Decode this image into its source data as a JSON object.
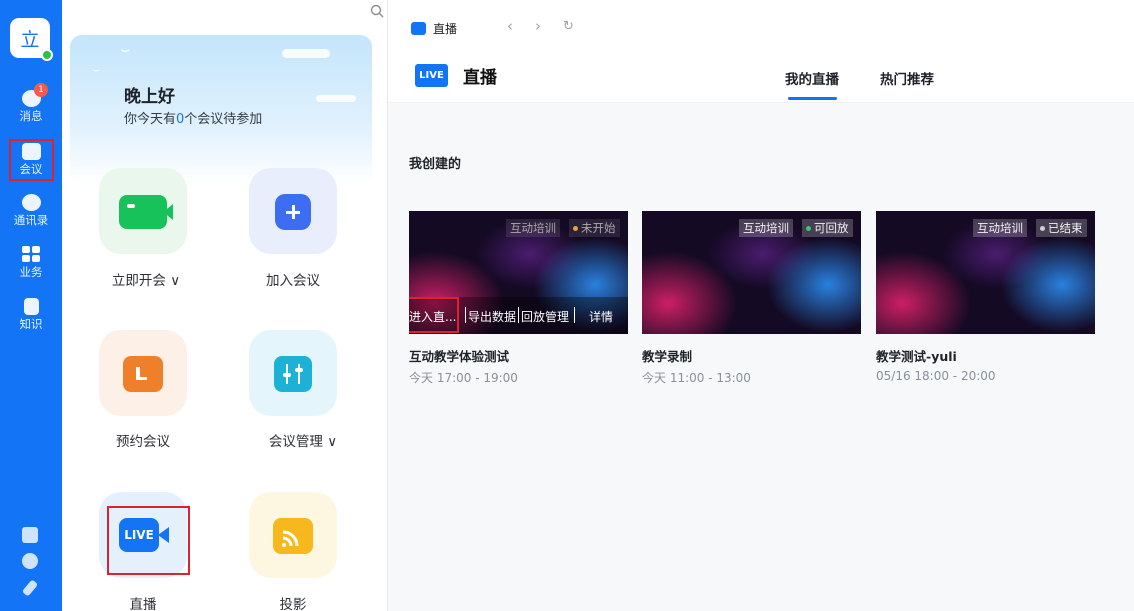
{
  "rail": {
    "avatar_char": "立",
    "messages_badge": "1",
    "items": [
      {
        "label": "消息"
      },
      {
        "label": "会议"
      },
      {
        "label": "通讯录"
      },
      {
        "label": "业务"
      },
      {
        "label": "知识"
      }
    ],
    "accent_color": "#1474f6"
  },
  "dashboard": {
    "greeting": "晚上好",
    "meeting_prefix": "你今天有",
    "meeting_count": "0",
    "meeting_suffix": "个会议待参加",
    "tiles": [
      {
        "label": "立即开会 ∨",
        "icon": "video-camera-icon"
      },
      {
        "label": "加入会议",
        "icon": "plus-icon"
      },
      {
        "label": "预约会议",
        "icon": "calendar-icon"
      },
      {
        "label": "会议管理 ∨",
        "icon": "sliders-icon"
      },
      {
        "label": "直播",
        "icon": "live-icon",
        "icon_text": "LIVE"
      },
      {
        "label": "投影",
        "icon": "cast-icon"
      }
    ]
  },
  "live_window": {
    "window_title": "直播",
    "logo_text": "LIVE",
    "title": "直播",
    "tabs": [
      {
        "label": "我的直播",
        "active": true
      },
      {
        "label": "热门推荐",
        "active": false
      }
    ],
    "section_title": "我创建的",
    "cards": [
      {
        "category": "互动培训",
        "status": "未开始",
        "status_color": "#e6a23c",
        "name": "互动教学体验测试",
        "time": "今天 17:00 - 19:00",
        "actions": [
          "进入直...",
          "导出数据",
          "回放管理",
          "详情"
        ]
      },
      {
        "category": "互动培训",
        "status": "可回放",
        "status_color": "#3ec46d",
        "name": "教学录制",
        "time": "今天 11:00 - 13:00"
      },
      {
        "category": "互动培训",
        "status": "已结束",
        "status_color": "#d0d0d0",
        "name": "教学测试-yuli",
        "time": "05/16 18:00 - 20:00"
      }
    ]
  }
}
